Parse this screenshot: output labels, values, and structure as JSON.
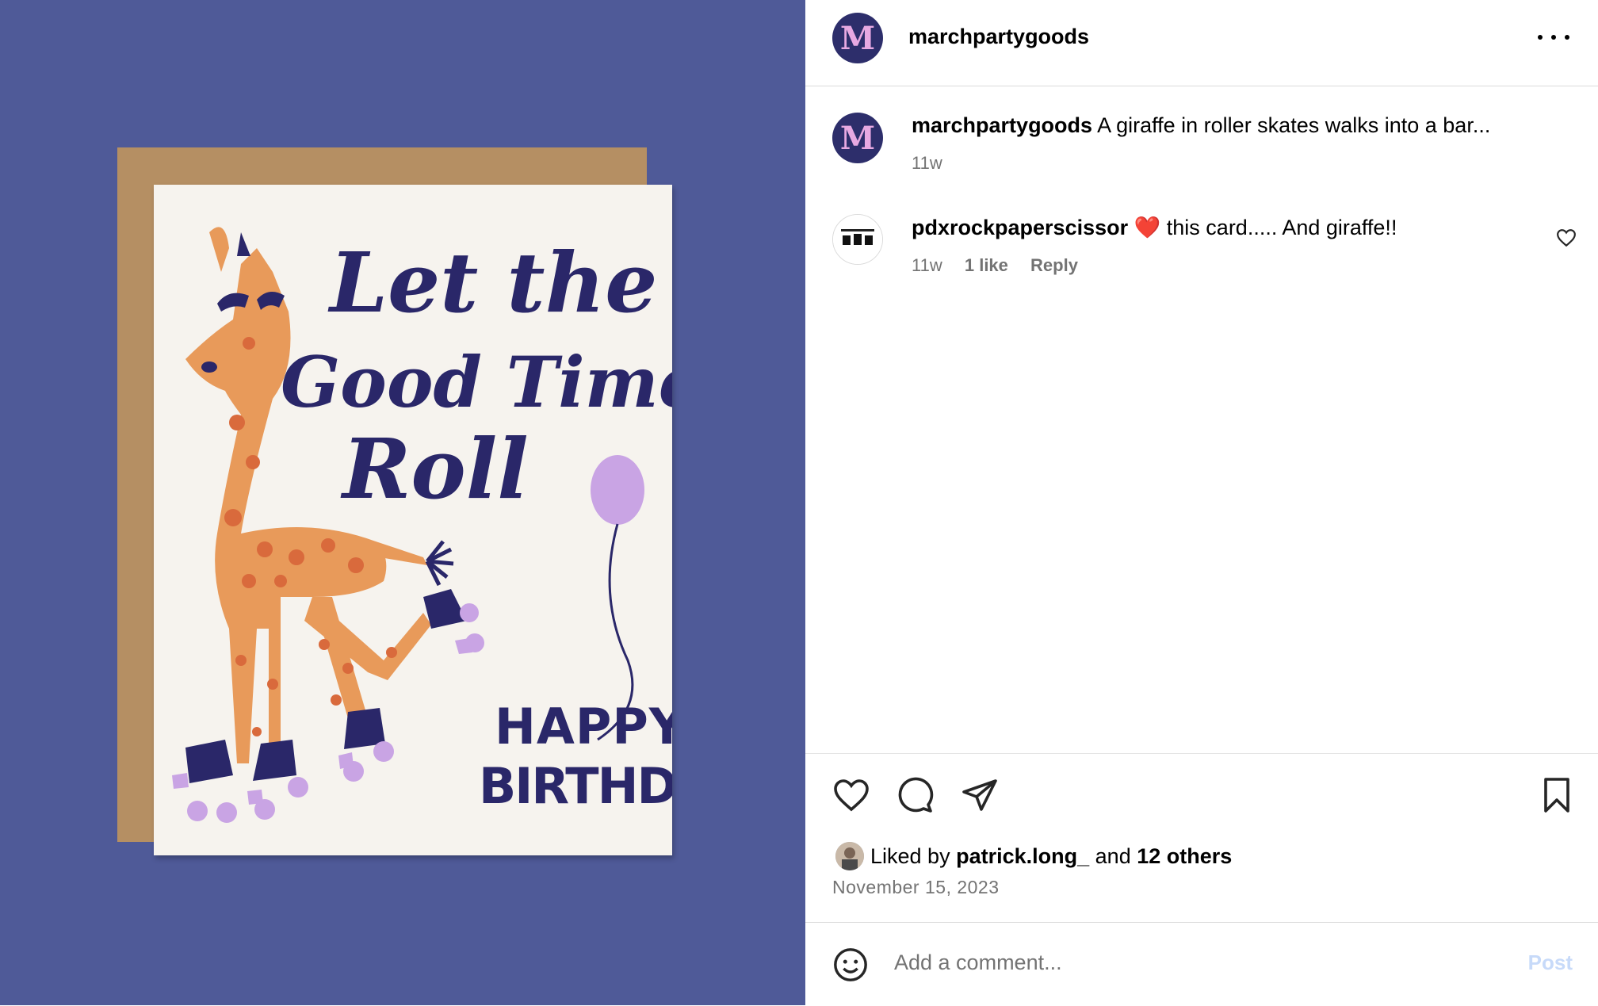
{
  "post": {
    "username": "marchpartygoods",
    "avatar_letter": "M",
    "caption": "A giraffe in roller skates walks into a bar...",
    "caption_age": "11w"
  },
  "card": {
    "line1": "Let the",
    "line2": "Good Times",
    "line3": "Roll",
    "line4": "HAPPY",
    "line5": "BIRTHDAY"
  },
  "comment": {
    "username": "pdxrockpaperscissor",
    "emoji": "❤️",
    "text": "this card..... And giraffe!!",
    "age": "11w",
    "likes": "1 like",
    "reply": "Reply"
  },
  "engagement": {
    "liked_by_prefix": "Liked by",
    "liked_by_user": "patrick.long_",
    "and": "and",
    "others": "12 others",
    "date": "November 15, 2023"
  },
  "add_comment": {
    "placeholder": "Add a comment...",
    "post_label": "Post"
  },
  "colors": {
    "background": "#4f5a98",
    "card_ink": "#2a2769",
    "giraffe": "#e89a5a",
    "lilac": "#c9a4e4",
    "post_disabled": "#c7daf9"
  },
  "icons": [
    "more-icon",
    "heart-icon",
    "comment-icon",
    "share-icon",
    "bookmark-icon",
    "emoji-icon"
  ]
}
